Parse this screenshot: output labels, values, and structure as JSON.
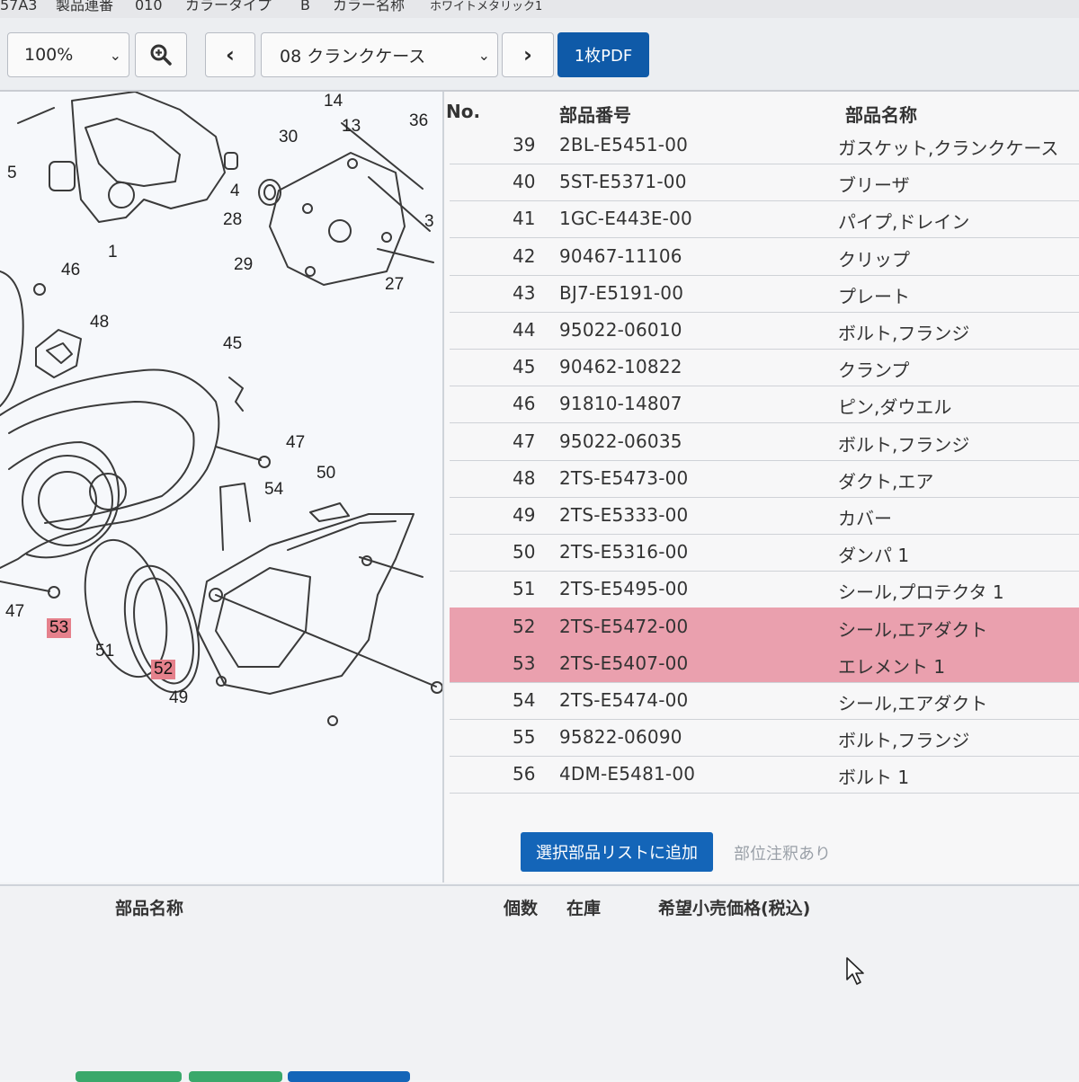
{
  "info": {
    "model": "57A3",
    "serial_label": "製品連番",
    "serial_value": "010",
    "color_type_label": "カラータイプ",
    "color_type_value": "B",
    "color_name_label": "カラー名称",
    "color_name_value": "ホワイトメタリック1"
  },
  "toolbar": {
    "zoom": "100%",
    "part_group": "08 クランクケース",
    "pdf_label": "1枚PDF",
    "prev_glyph": "‹",
    "next_glyph": "›",
    "chevron": "⌄"
  },
  "diagram": {
    "callouts": [
      "14",
      "13",
      "36",
      "5",
      "30",
      "4",
      "28",
      "3",
      "1",
      "29",
      "27",
      "46",
      "48",
      "45",
      "47",
      "50",
      "54",
      "47",
      "53",
      "51",
      "52",
      "49"
    ]
  },
  "parts_table": {
    "headers": {
      "no": "No.",
      "part_number": "部品番号",
      "part_name": "部品名称"
    },
    "rows": [
      {
        "no": "39",
        "part_number": "2BL-E5451-00",
        "part_name": "ガスケット,クランクケース",
        "highlighted": false
      },
      {
        "no": "40",
        "part_number": "5ST-E5371-00",
        "part_name": "ブリーザ",
        "highlighted": false
      },
      {
        "no": "41",
        "part_number": "1GC-E443E-00",
        "part_name": "パイプ,ドレイン",
        "highlighted": false
      },
      {
        "no": "42",
        "part_number": "90467-11106",
        "part_name": "クリップ",
        "highlighted": false
      },
      {
        "no": "43",
        "part_number": "BJ7-E5191-00",
        "part_name": "プレート",
        "highlighted": false
      },
      {
        "no": "44",
        "part_number": "95022-06010",
        "part_name": "ボルト,フランジ",
        "highlighted": false
      },
      {
        "no": "45",
        "part_number": "90462-10822",
        "part_name": "クランプ",
        "highlighted": false
      },
      {
        "no": "46",
        "part_number": "91810-14807",
        "part_name": "ピン,ダウエル",
        "highlighted": false
      },
      {
        "no": "47",
        "part_number": "95022-06035",
        "part_name": "ボルト,フランジ",
        "highlighted": false
      },
      {
        "no": "48",
        "part_number": "2TS-E5473-00",
        "part_name": "ダクト,エア",
        "highlighted": false
      },
      {
        "no": "49",
        "part_number": "2TS-E5333-00",
        "part_name": "カバー",
        "highlighted": false
      },
      {
        "no": "50",
        "part_number": "2TS-E5316-00",
        "part_name": "ダンパ 1",
        "highlighted": false
      },
      {
        "no": "51",
        "part_number": "2TS-E5495-00",
        "part_name": "シール,プロテクタ 1",
        "highlighted": false
      },
      {
        "no": "52",
        "part_number": "2TS-E5472-00",
        "part_name": "シール,エアダクト",
        "highlighted": true
      },
      {
        "no": "53",
        "part_number": "2TS-E5407-00",
        "part_name": "エレメント 1",
        "highlighted": true
      },
      {
        "no": "54",
        "part_number": "2TS-E5474-00",
        "part_name": "シール,エアダクト",
        "highlighted": false
      },
      {
        "no": "55",
        "part_number": "95822-06090",
        "part_name": "ボルト,フランジ",
        "highlighted": false
      },
      {
        "no": "56",
        "part_number": "4DM-E5481-00",
        "part_name": "ボルト 1",
        "highlighted": false
      }
    ],
    "add_button": "選択部品リストに追加",
    "note_link": "部位注釈あり"
  },
  "selected_list": {
    "headers": {
      "part_name": "部品名称",
      "qty": "個数",
      "stock": "在庫",
      "price": "希望小売価格(税込)"
    }
  },
  "colors": {
    "primary": "#0f5aa8",
    "highlight_row": "#eaa0ae",
    "highlight_callout": "#e5818c",
    "bottom_green": "#3aa86b",
    "bottom_blue": "#1465b8"
  }
}
